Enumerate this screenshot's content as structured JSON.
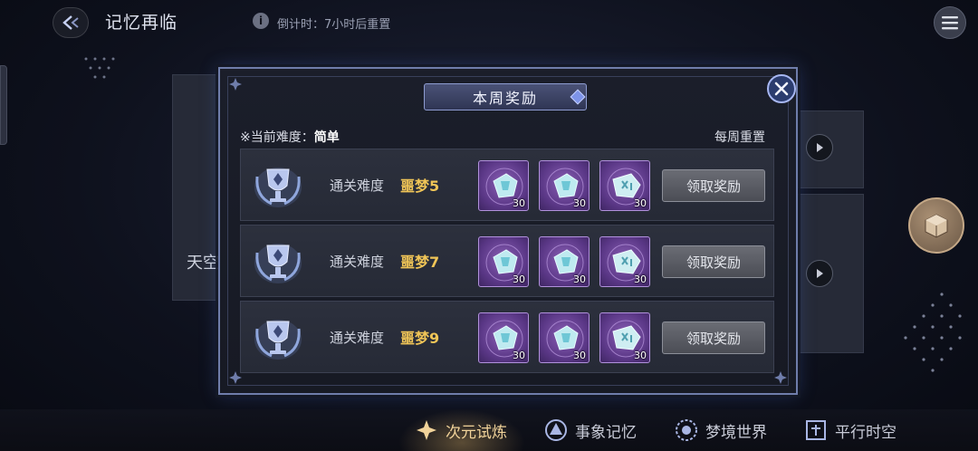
{
  "header": {
    "title": "记忆再临",
    "back_icon": "back-arrow-icon",
    "info_icon_glyph": "i",
    "countdown": "倒计时：7小时后重置",
    "menu_icon": "hamburger-menu-icon"
  },
  "background": {
    "partial_text": "天空"
  },
  "modal": {
    "title": "本周奖励",
    "difficulty_label": "当前难度：",
    "difficulty_value": "简单",
    "difficulty_prefix": "※",
    "weekly_reset": "每周重置",
    "rows": [
      {
        "requirement_label": "通关难度",
        "requirement_value": "噩梦5",
        "items": [
          {
            "qty": "30"
          },
          {
            "qty": "30"
          },
          {
            "qty": "30"
          }
        ],
        "claim_label": "领取奖励"
      },
      {
        "requirement_label": "通关难度",
        "requirement_value": "噩梦7",
        "items": [
          {
            "qty": "30"
          },
          {
            "qty": "30"
          },
          {
            "qty": "30"
          }
        ],
        "claim_label": "领取奖励"
      },
      {
        "requirement_label": "通关难度",
        "requirement_value": "噩梦9",
        "items": [
          {
            "qty": "30"
          },
          {
            "qty": "30"
          },
          {
            "qty": "30"
          }
        ],
        "claim_label": "领取奖励"
      }
    ]
  },
  "bottom_nav": {
    "tabs": [
      {
        "label": "次元试炼",
        "icon": "diamond-star-icon",
        "active": true
      },
      {
        "label": "事象记忆",
        "icon": "triangle-orb-icon",
        "active": false
      },
      {
        "label": "梦境世界",
        "icon": "dream-globe-icon",
        "active": false
      },
      {
        "label": "平行时空",
        "icon": "portal-gate-icon",
        "active": false
      }
    ]
  },
  "colors": {
    "accent_gold": "#f0c557",
    "modal_border": "#6f7dab",
    "item_purple": "#5a3786"
  }
}
